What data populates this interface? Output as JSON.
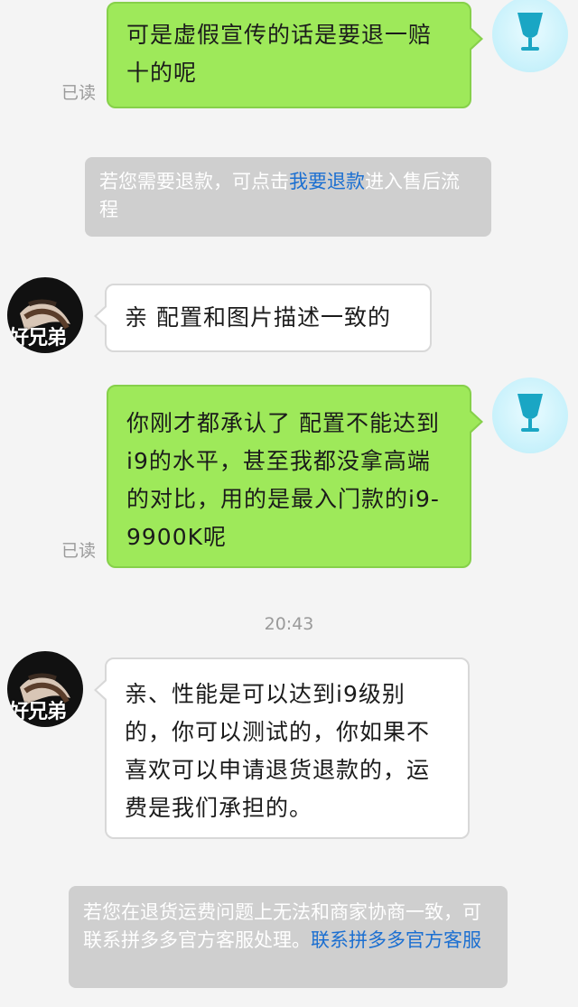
{
  "messages": [
    {
      "id": "m1",
      "text": "可是虚假宣传的话是要退一赔十的呢",
      "read": "已读"
    },
    {
      "id": "n1",
      "pre": "若您需要退款，可点击",
      "link": "我要退款",
      "post": "进入售后流程"
    },
    {
      "id": "m2",
      "text": "亲  配置和图片描述一致的"
    },
    {
      "id": "m3",
      "text": "你刚才都承认了    配置不能达到i9的水平，甚至我都没拿高端的对比，用的是最入门款的i9-9900K呢",
      "read": "已读"
    },
    {
      "id": "ts",
      "text": "20:43"
    },
    {
      "id": "m4",
      "text": "亲、性能是可以达到i9级别的，你可以测试的，你如果不喜欢可以申请退货退款的，运费是我们承担的。"
    },
    {
      "id": "n2",
      "pre": "若您在退货运费问题上无法和商家协商一致，可联系拼多多官方客服处理。",
      "link": "联系拼多多官方客服"
    }
  ],
  "avatars": {
    "merchant_caption": "好兄弟",
    "me_icon": "wine-glass-icon"
  },
  "colors": {
    "outgoing_bubble": "#9ee95a",
    "incoming_bubble": "#ffffff",
    "notice_bg": "#cfcfcf",
    "link": "#1b6fd1"
  }
}
